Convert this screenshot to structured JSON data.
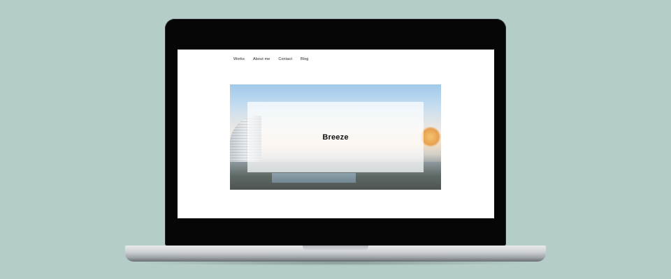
{
  "nav": {
    "items": [
      {
        "label": "Works"
      },
      {
        "label": "About me"
      },
      {
        "label": "Contact"
      },
      {
        "label": "Blog"
      }
    ]
  },
  "hero": {
    "title": "Breeze"
  },
  "colors": {
    "background": "#b5cdc8",
    "laptop_bezel": "#050505",
    "screen": "#ffffff",
    "title_text": "#111111"
  }
}
